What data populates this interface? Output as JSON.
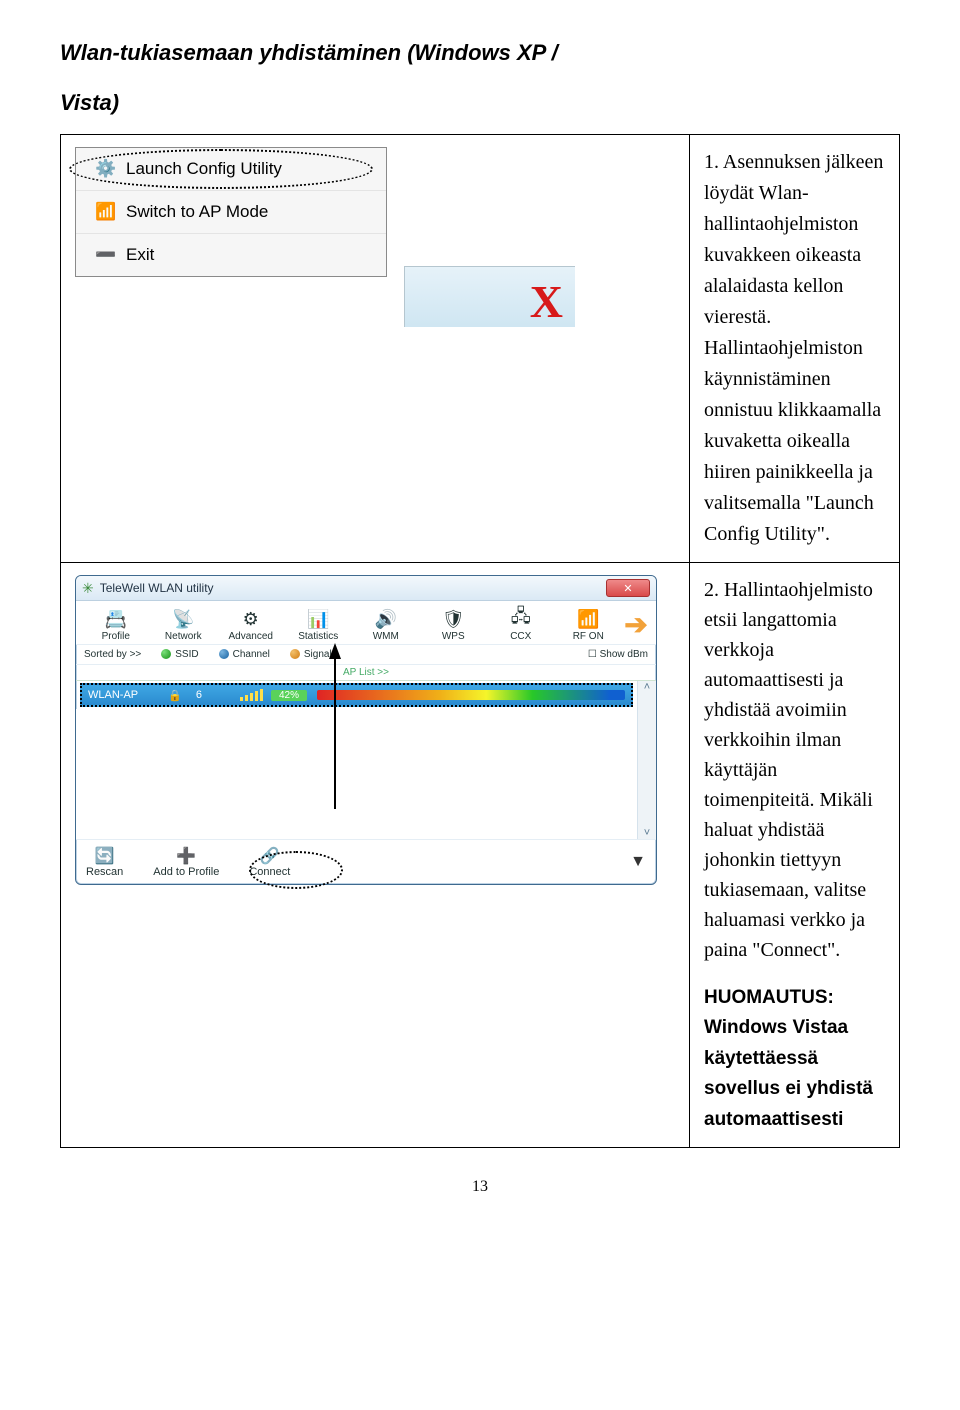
{
  "heading": {
    "line1": "Wlan-tukiasemaan yhdistäminen (Windows XP /",
    "line2": "Vista)"
  },
  "contextMenu": {
    "items": [
      {
        "label": "Launch Config Utility",
        "icon": "gear-icon"
      },
      {
        "label": "Switch to AP Mode",
        "icon": "antenna-icon"
      },
      {
        "label": "Exit",
        "icon": "minus-icon"
      }
    ],
    "closeGlyph": "X"
  },
  "step1": {
    "text": "1. Asennuksen jälkeen löydät Wlan-hallintaohjelmiston kuvakkeen oikeasta alalaidasta kellon vierestä. Hallintaohjelmiston käynnistäminen onnistuu klikkaamalla kuvaketta oikealla hiiren painikkeella ja valitsemalla \"Launch Config Utility\"."
  },
  "wlan": {
    "windowTitle": "TeleWell WLAN utility",
    "toolbar": [
      "Profile",
      "Network",
      "Advanced",
      "Statistics",
      "WMM",
      "WPS",
      "CCX",
      "RF ON"
    ],
    "sortbar": {
      "label": "Sorted by >>",
      "ssid": "SSID",
      "channel": "Channel",
      "signal": "Signal",
      "showdbm": "Show dBm"
    },
    "aplist_label": "AP List >>",
    "row": {
      "ssid": "WLAN-AP",
      "channel": "6",
      "pct": "42%"
    },
    "bottom": [
      "Rescan",
      "Add to Profile",
      "Connect"
    ]
  },
  "step2": {
    "text": "2. Hallintaohjelmisto etsii langattomia verkkoja automaattisesti ja yhdistää avoimiin verkkoihin ilman käyttäjän toimenpiteitä. Mikäli haluat yhdistää johonkin tiettyyn tukiasemaan, valitse haluamasi verkko ja paina \"Connect\".",
    "note_label": "HUOMAUTUS:",
    "note_body": "Windows Vistaa käytettäessä sovellus ei yhdistä automaattisesti"
  },
  "page_number": "13"
}
